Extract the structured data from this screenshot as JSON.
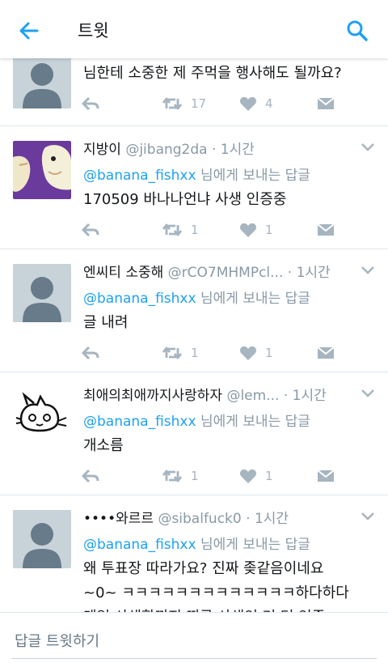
{
  "header": {
    "title": "트윗"
  },
  "tweets": [
    {
      "text": "님한테 소중한 제 주먹을 행사해도 될까요?",
      "retweets": "17",
      "likes": "4"
    },
    {
      "name": "지방이",
      "handle": "@jibang2da",
      "time": "1시간",
      "reply_mention": "@banana_fishxx",
      "reply_suffix": " 님에게 보내는 답글",
      "text": "170509 바나나언냐 사생 인증중",
      "retweets": "1",
      "likes": "1"
    },
    {
      "name": "엔씨티 소중해",
      "handle": "@rCO7MHMPcl...",
      "time": "1시간",
      "reply_mention": "@banana_fishxx",
      "reply_suffix": " 님에게 보내는 답글",
      "text": "글 내려",
      "retweets": "1",
      "likes": "1"
    },
    {
      "name": "최애의최애까지사랑하자",
      "handle": "@lem...",
      "time": "1시간",
      "reply_mention": "@banana_fishxx",
      "reply_suffix": " 님에게 보내는 답글",
      "text": "개소름",
      "retweets": "1",
      "likes": "1"
    },
    {
      "name": "••••와르르",
      "handle": "@sibalfuck0",
      "time": "1시간",
      "reply_mention": "@banana_fishxx",
      "reply_suffix": " 님에게 보내는 답글",
      "text_line1": "왜 투표장 따라가요? 진짜 좆같음이네요",
      "text_line2": "~0~ ㅋㅋㅋㅋㅋㅋㅋㅋㅋㅋㅋㅋㅋ하다하다",
      "text_line3": "게임 사생할끼지 찌금 사생인 거 더 인증"
    }
  ],
  "compose": {
    "placeholder": "답글 트윗하기"
  },
  "colors": {
    "accent": "#1da1f2",
    "muted": "#8899a6",
    "icon": "#a6b5c0"
  },
  "icons": [
    "back-arrow-icon",
    "search-icon",
    "reply-icon",
    "retweet-icon",
    "heart-icon",
    "direct-message-icon",
    "chevron-down-icon",
    "default-avatar-icon"
  ]
}
